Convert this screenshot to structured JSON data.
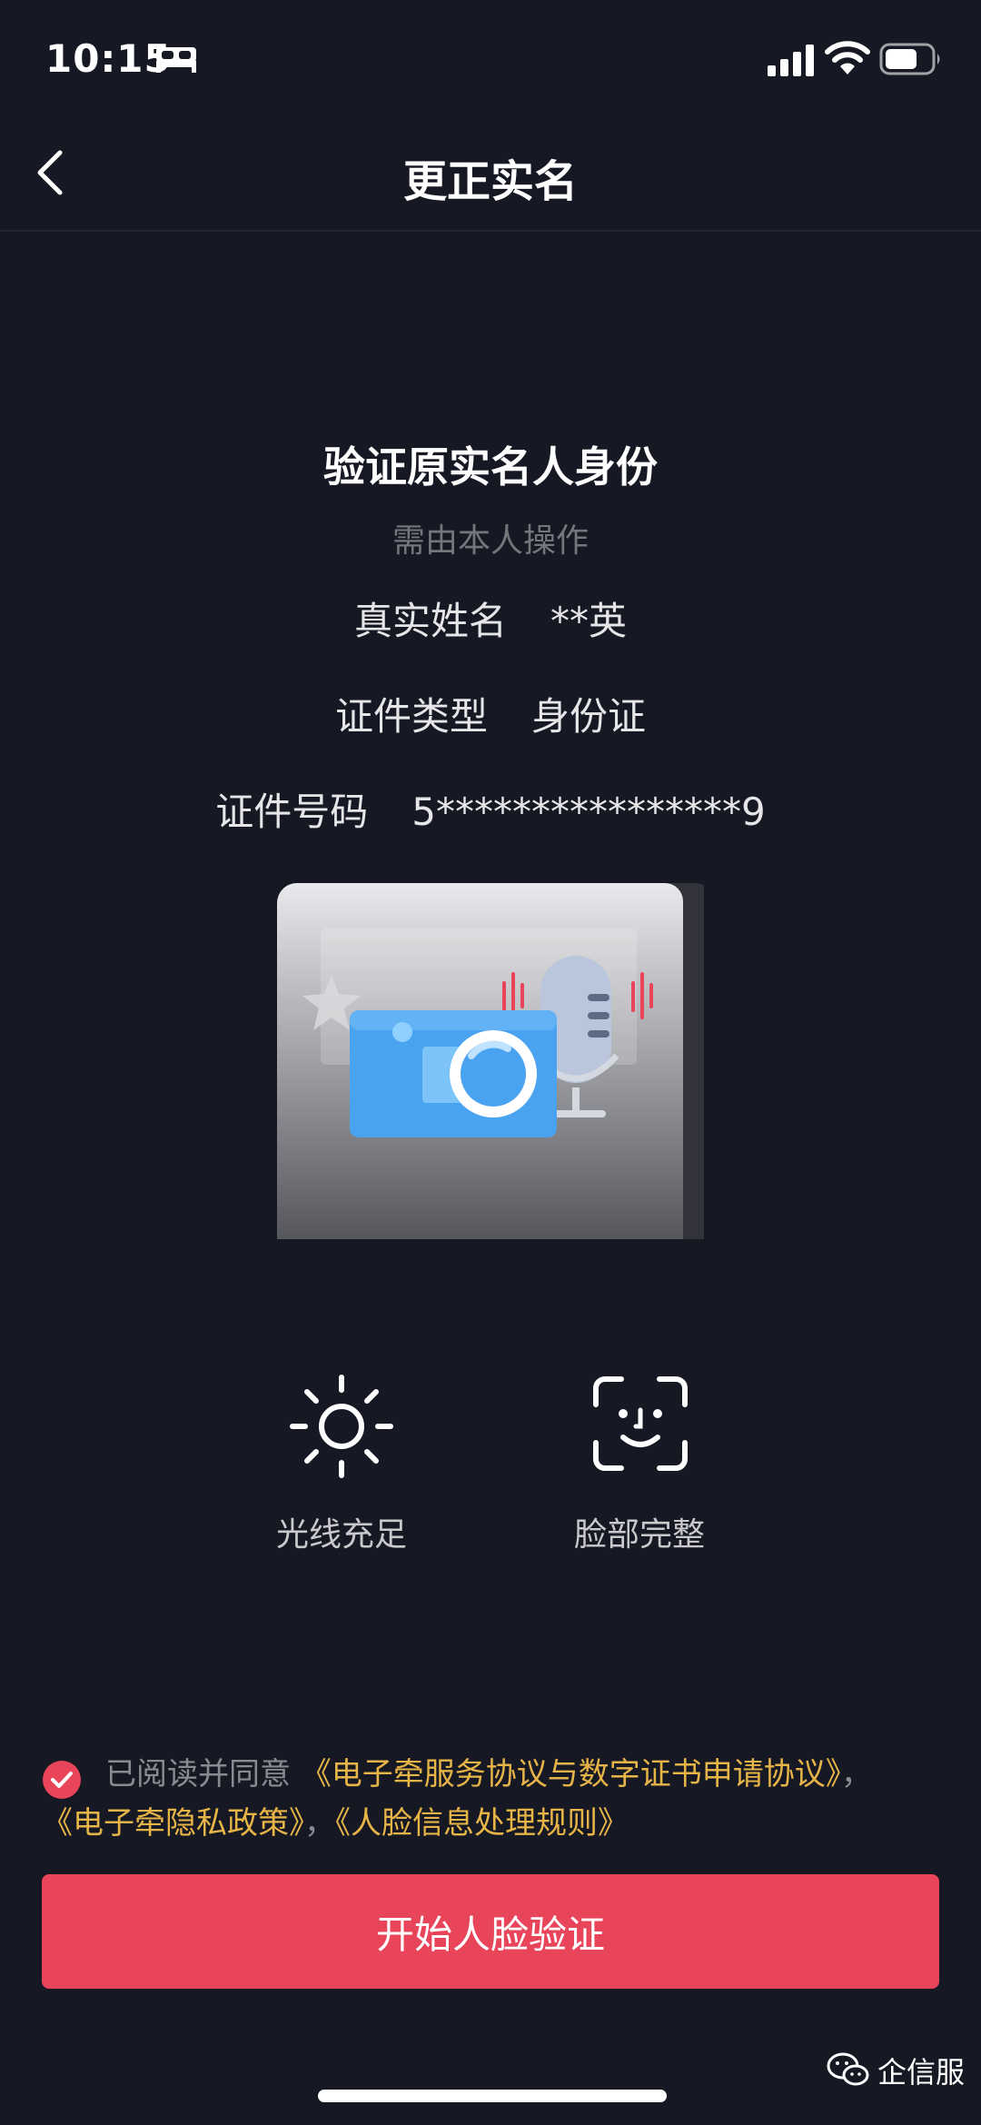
{
  "status_bar": {
    "time": "10:15",
    "icons": [
      "bed-icon",
      "cellular-signal-icon",
      "wifi-icon",
      "battery-icon"
    ]
  },
  "nav": {
    "back_icon": "chevron-left-icon",
    "title": "更正实名"
  },
  "verify": {
    "heading": "验证原实名人身份",
    "subheading": "需由本人操作",
    "fields": [
      {
        "label": "真实姓名",
        "value": "**英"
      },
      {
        "label": "证件类型",
        "value": "身份证"
      },
      {
        "label": "证件号码",
        "value": "5****************9"
      }
    ],
    "illustration_icons": [
      "camera-icon",
      "microphone-icon",
      "star-icon"
    ]
  },
  "tips": [
    {
      "icon": "sun-icon",
      "label": "光线充足"
    },
    {
      "icon": "face-scan-icon",
      "label": "脸部完整"
    }
  ],
  "agreement": {
    "checked": true,
    "prefix": "已阅读并同意",
    "link1": "《电子牵服务协议与数字证书申请协议》",
    "sep1": "，",
    "link2": "《电子牵隐私政策》",
    "sep2": "，",
    "link3": "《人脸信息处理规则》"
  },
  "primary_button": {
    "label": "开始人脸验证"
  },
  "watermark": {
    "text": "企信服",
    "icon": "wechat-icon"
  },
  "colors": {
    "background": "#161823",
    "primary": "#e8445a",
    "link": "#e7b547",
    "muted": "#75767c"
  }
}
